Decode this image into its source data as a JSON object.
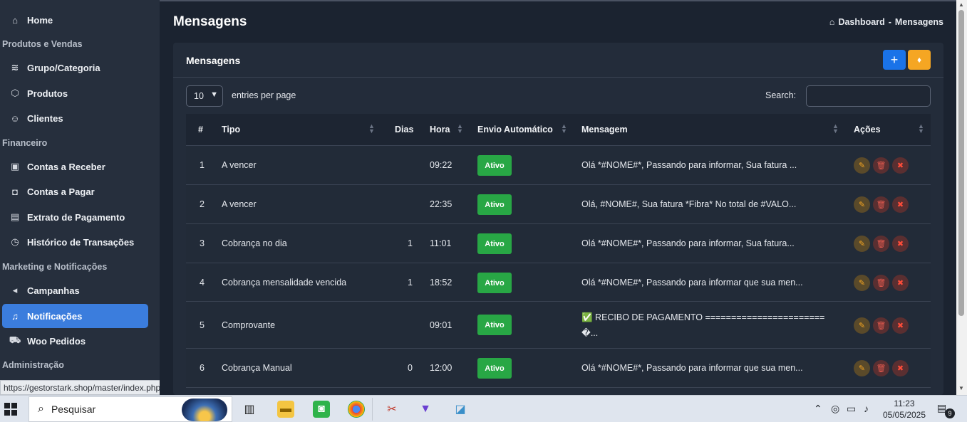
{
  "sidebar": {
    "items": [
      {
        "label": "Home",
        "icon": "home-icon",
        "glyph": "⌂"
      },
      {
        "label": "Grupo/Categoria",
        "icon": "layers-icon",
        "glyph": "≋"
      },
      {
        "label": "Produtos",
        "icon": "box-icon",
        "glyph": "⬡"
      },
      {
        "label": "Clientes",
        "icon": "user-icon",
        "glyph": "☺"
      },
      {
        "label": "Contas a Receber",
        "icon": "cash-in-icon",
        "glyph": "▣"
      },
      {
        "label": "Contas a Pagar",
        "icon": "cash-out-icon",
        "glyph": "◘"
      },
      {
        "label": "Extrato de Pagamento",
        "icon": "statement-icon",
        "glyph": "▤"
      },
      {
        "label": "Histórico de Transações",
        "icon": "history-icon",
        "glyph": "◷"
      },
      {
        "label": "Campanhas",
        "icon": "megaphone-icon",
        "glyph": "◂"
      },
      {
        "label": "Notificações",
        "icon": "bell-icon",
        "glyph": "♫"
      },
      {
        "label": "Woo Pedidos",
        "icon": "cart-icon",
        "glyph": "⛟"
      }
    ],
    "sections": [
      "Produtos e Vendas",
      "Financeiro",
      "Marketing e Notificações",
      "Administração"
    ],
    "status_url": "https://gestorstark.shop/master/index.php"
  },
  "header": {
    "title": "Mensagens",
    "breadcrumb_home": "Dashboard",
    "breadcrumb_sep": "-",
    "breadcrumb_current": "Mensagens"
  },
  "card": {
    "title": "Mensagens",
    "add_glyph": "+",
    "tip_glyph": "♦"
  },
  "controls": {
    "page_length": "10",
    "length_label": "entries per page",
    "search_label": "Search:",
    "search_value": ""
  },
  "table": {
    "columns": [
      "#",
      "Tipo",
      "Dias",
      "Hora",
      "Envio Automático",
      "Mensagem",
      "Ações"
    ],
    "rows": [
      {
        "num": "1",
        "tipo": "A vencer",
        "dias": "",
        "hora": "09:22",
        "envio": "Ativo",
        "msg1": "Olá *#NOME#*, Passando para informar, Sua fatura ...",
        "msg2": ""
      },
      {
        "num": "2",
        "tipo": "A vencer",
        "dias": "",
        "hora": "22:35",
        "envio": "Ativo",
        "msg1": "Olá, #NOME#, Sua fatura *Fibra* No total de #VALO...",
        "msg2": ""
      },
      {
        "num": "3",
        "tipo": "Cobrança no dia",
        "dias": "1",
        "hora": "11:01",
        "envio": "Ativo",
        "msg1": "Olá *#NOME#*, Passando para informar, Sua fatura...",
        "msg2": ""
      },
      {
        "num": "4",
        "tipo": "Cobrança mensalidade vencida",
        "dias": "1",
        "hora": "18:52",
        "envio": "Ativo",
        "msg1": "Olá *#NOME#*, Passando para informar que sua men...",
        "msg2": ""
      },
      {
        "num": "5",
        "tipo": "Comprovante",
        "dias": "",
        "hora": "09:01",
        "envio": "Ativo",
        "msg1": "✅ RECIBO DE PAGAMENTO =======================",
        "msg2": "�..."
      },
      {
        "num": "6",
        "tipo": "Cobrança Manual",
        "dias": "0",
        "hora": "12:00",
        "envio": "Ativo",
        "msg1": "Olá *#NOME#*, Passando para informar que sua men...",
        "msg2": ""
      }
    ],
    "action_glyphs": {
      "edit": "✎",
      "delete": "🗑",
      "close": "✖"
    }
  },
  "taskbar": {
    "search_placeholder": "Pesquisar",
    "time": "11:23",
    "date": "05/05/2025",
    "notification_count": "9"
  },
  "colors": {
    "accent": "#3b7ddd",
    "success": "#28a745",
    "warning": "#f5a623",
    "danger": "#e05a4f"
  }
}
